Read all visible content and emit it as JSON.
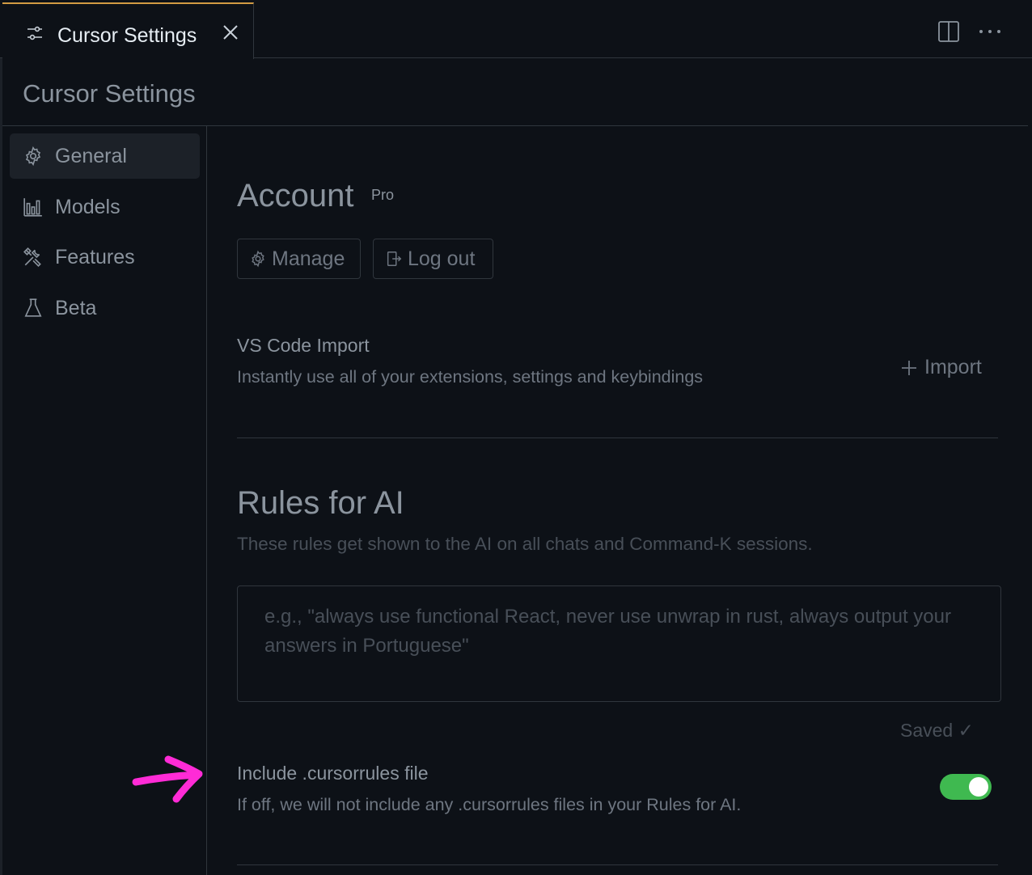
{
  "tab": {
    "title": "Cursor Settings",
    "icon": "settings-sliders-icon"
  },
  "header": {
    "title": "Cursor Settings"
  },
  "sidebar": {
    "items": [
      {
        "label": "General",
        "icon": "gear-icon",
        "active": true
      },
      {
        "label": "Models",
        "icon": "bar-chart-icon",
        "active": false
      },
      {
        "label": "Features",
        "icon": "tools-icon",
        "active": false
      },
      {
        "label": "Beta",
        "icon": "flask-icon",
        "active": false
      }
    ]
  },
  "account": {
    "title": "Account",
    "badge": "Pro",
    "manage_label": "Manage",
    "logout_label": "Log out"
  },
  "vscode_import": {
    "title": "VS Code Import",
    "description": "Instantly use all of your extensions, settings and keybindings",
    "button_label": "Import"
  },
  "rules": {
    "title": "Rules for AI",
    "description": "These rules get shown to the AI on all chats and Command-K sessions.",
    "placeholder": "e.g., \"always use functional React, never use unwrap in rust, always output your answers in Portuguese\"",
    "value": "",
    "status": "Saved ✓"
  },
  "cursorrules": {
    "title": "Include .cursorrules file",
    "description": "If off, we will not include any .cursorrules files in your Rules for AI.",
    "enabled": true
  },
  "colors": {
    "background": "#0d1117",
    "tab_accent": "#d29b43",
    "toggle_on": "#3fb950",
    "annotation_arrow": "#ff2bd6"
  }
}
